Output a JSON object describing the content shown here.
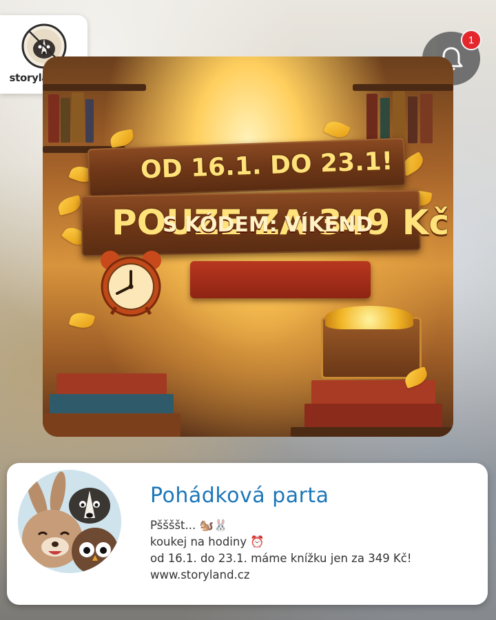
{
  "brand": {
    "logo_text": "storyland.cz",
    "logo_icon": "badger-logo-icon"
  },
  "notifications": {
    "icon": "bell-icon",
    "count": "1",
    "badge_color": "#e3272d"
  },
  "banner": {
    "line1": "OD 16.1. DO 23.1!",
    "line2": "POUZE ZA 349 Kč",
    "line3": "S KÓDEM: VÍKEND",
    "text_color": "#ffe27a",
    "ribbon_color": "#b8371f"
  },
  "post": {
    "author": "Pohádková parta",
    "line1": "Pššššt... 🐿️🐰",
    "line2": "koukej na hodiny ⏰",
    "line3": "od 16.1. do 23.1. máme knížku jen za 349 Kč!",
    "line4": "www.storyland.cz",
    "author_color": "#1c76b8"
  }
}
